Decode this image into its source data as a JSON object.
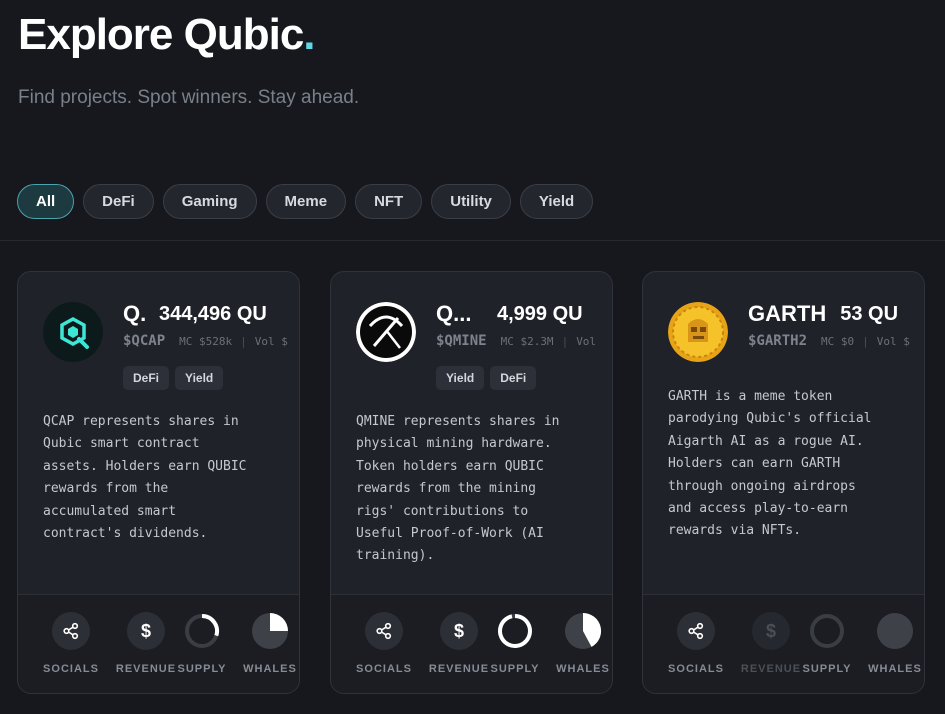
{
  "header": {
    "title": "Explore Qubic",
    "title_dot": ".",
    "subtitle": "Find projects. Spot winners. Stay ahead."
  },
  "filters": [
    "All",
    "DeFi",
    "Gaming",
    "Meme",
    "NFT",
    "Utility",
    "Yield"
  ],
  "active_filter": "All",
  "colors": {
    "accent": "#5fd6e8",
    "background": "#16181e",
    "card": "#1f2228"
  },
  "metric_labels": {
    "socials": "SOCIALS",
    "revenue": "REVENUE",
    "supply": "SUPPLY",
    "whales": "WHALES"
  },
  "cards": [
    {
      "name": "QCAP",
      "name_visible": "Q.",
      "price": "344,496 QU",
      "ticker": "$QCAP",
      "mc": "MC $528k",
      "sep": "|",
      "vol": "Vol $",
      "tags": [
        "DeFi",
        "Yield"
      ],
      "description": "QCAP represents shares in\nQubic smart contract\nassets. Holders earn QUBIC\nrewards from the\naccumulated smart\ncontract's dividends.",
      "logo_icon": "qcap-logo-icon",
      "revenue_enabled": true,
      "supply_fraction": 0.3,
      "whales_fraction": 0.25
    },
    {
      "name": "QMINE",
      "name_visible": "Q...",
      "price": "4,999 QU",
      "ticker": "$QMINE",
      "mc": "MC $2.3M",
      "sep": "|",
      "vol": "Vol",
      "tags": [
        "Yield",
        "DeFi"
      ],
      "description": "QMINE represents shares in\nphysical mining hardware.\nToken holders earn QUBIC\nrewards from the mining\nrigs' contributions to\nUseful Proof-of-Work (AI\ntraining).",
      "logo_icon": "pickaxe-icon",
      "revenue_enabled": true,
      "supply_fraction": 0.95,
      "whales_fraction": 0.42
    },
    {
      "name": "GARTH",
      "name_visible": "GARTH",
      "price": "53 QU",
      "ticker": "$GARTH2",
      "mc": "MC $0",
      "sep": "|",
      "vol": "Vol $",
      "tags": [],
      "description": "GARTH is a meme token\nparodying Qubic's official\nAigarth AI as a rogue AI.\nHolders can earn GARTH\nthrough ongoing airdrops\nand access play-to-earn\nrewards via NFTs.",
      "logo_icon": "garth-coin-icon",
      "revenue_enabled": false,
      "supply_fraction": 0,
      "whales_fraction": 0
    }
  ]
}
